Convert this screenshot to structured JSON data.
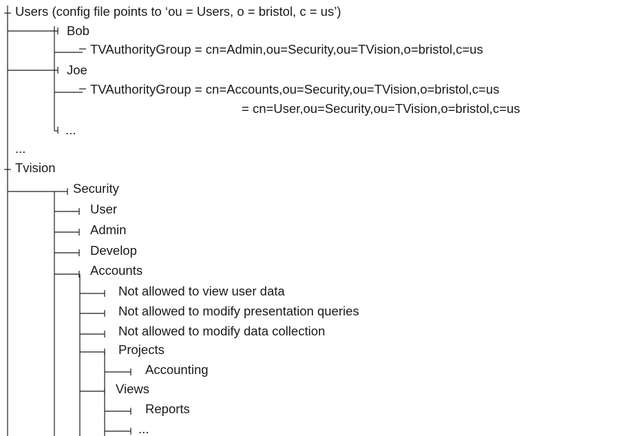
{
  "root_users": {
    "label": "Users (config file points to ‘ou = Users, o = bristol, c = us’)",
    "bob": {
      "label": "Bob",
      "group": "TVAuthorityGroup = cn=Admin,ou=Security,ou=TVision,o=bristol,c=us"
    },
    "joe": {
      "label": "Joe",
      "group_1": "TVAuthorityGroup = cn=Accounts,ou=Security,ou=TVision,o=bristol,c=us",
      "group_2": "= cn=User,ou=Security,ou=TVision,o=bristol,c=us"
    },
    "more_users": "...",
    "ellipsis": "..."
  },
  "root_tvision": {
    "label": "Tvision",
    "security": {
      "label": "Security",
      "user": "User",
      "admin": "Admin",
      "develop": "Develop",
      "accounts": {
        "label": "Accounts",
        "rule_1": "Not allowed to view user data",
        "rule_2": "Not allowed to modify presentation queries",
        "rule_3": "Not allowed to modify data collection",
        "projects": {
          "label": "Projects",
          "accounting": "Accounting"
        },
        "views": {
          "label": "Views",
          "reports": "Reports",
          "more": "..."
        }
      }
    }
  },
  "colors": {
    "line": "#1a1a1a",
    "text": "#1a1a1a",
    "background": "#ffffff"
  }
}
